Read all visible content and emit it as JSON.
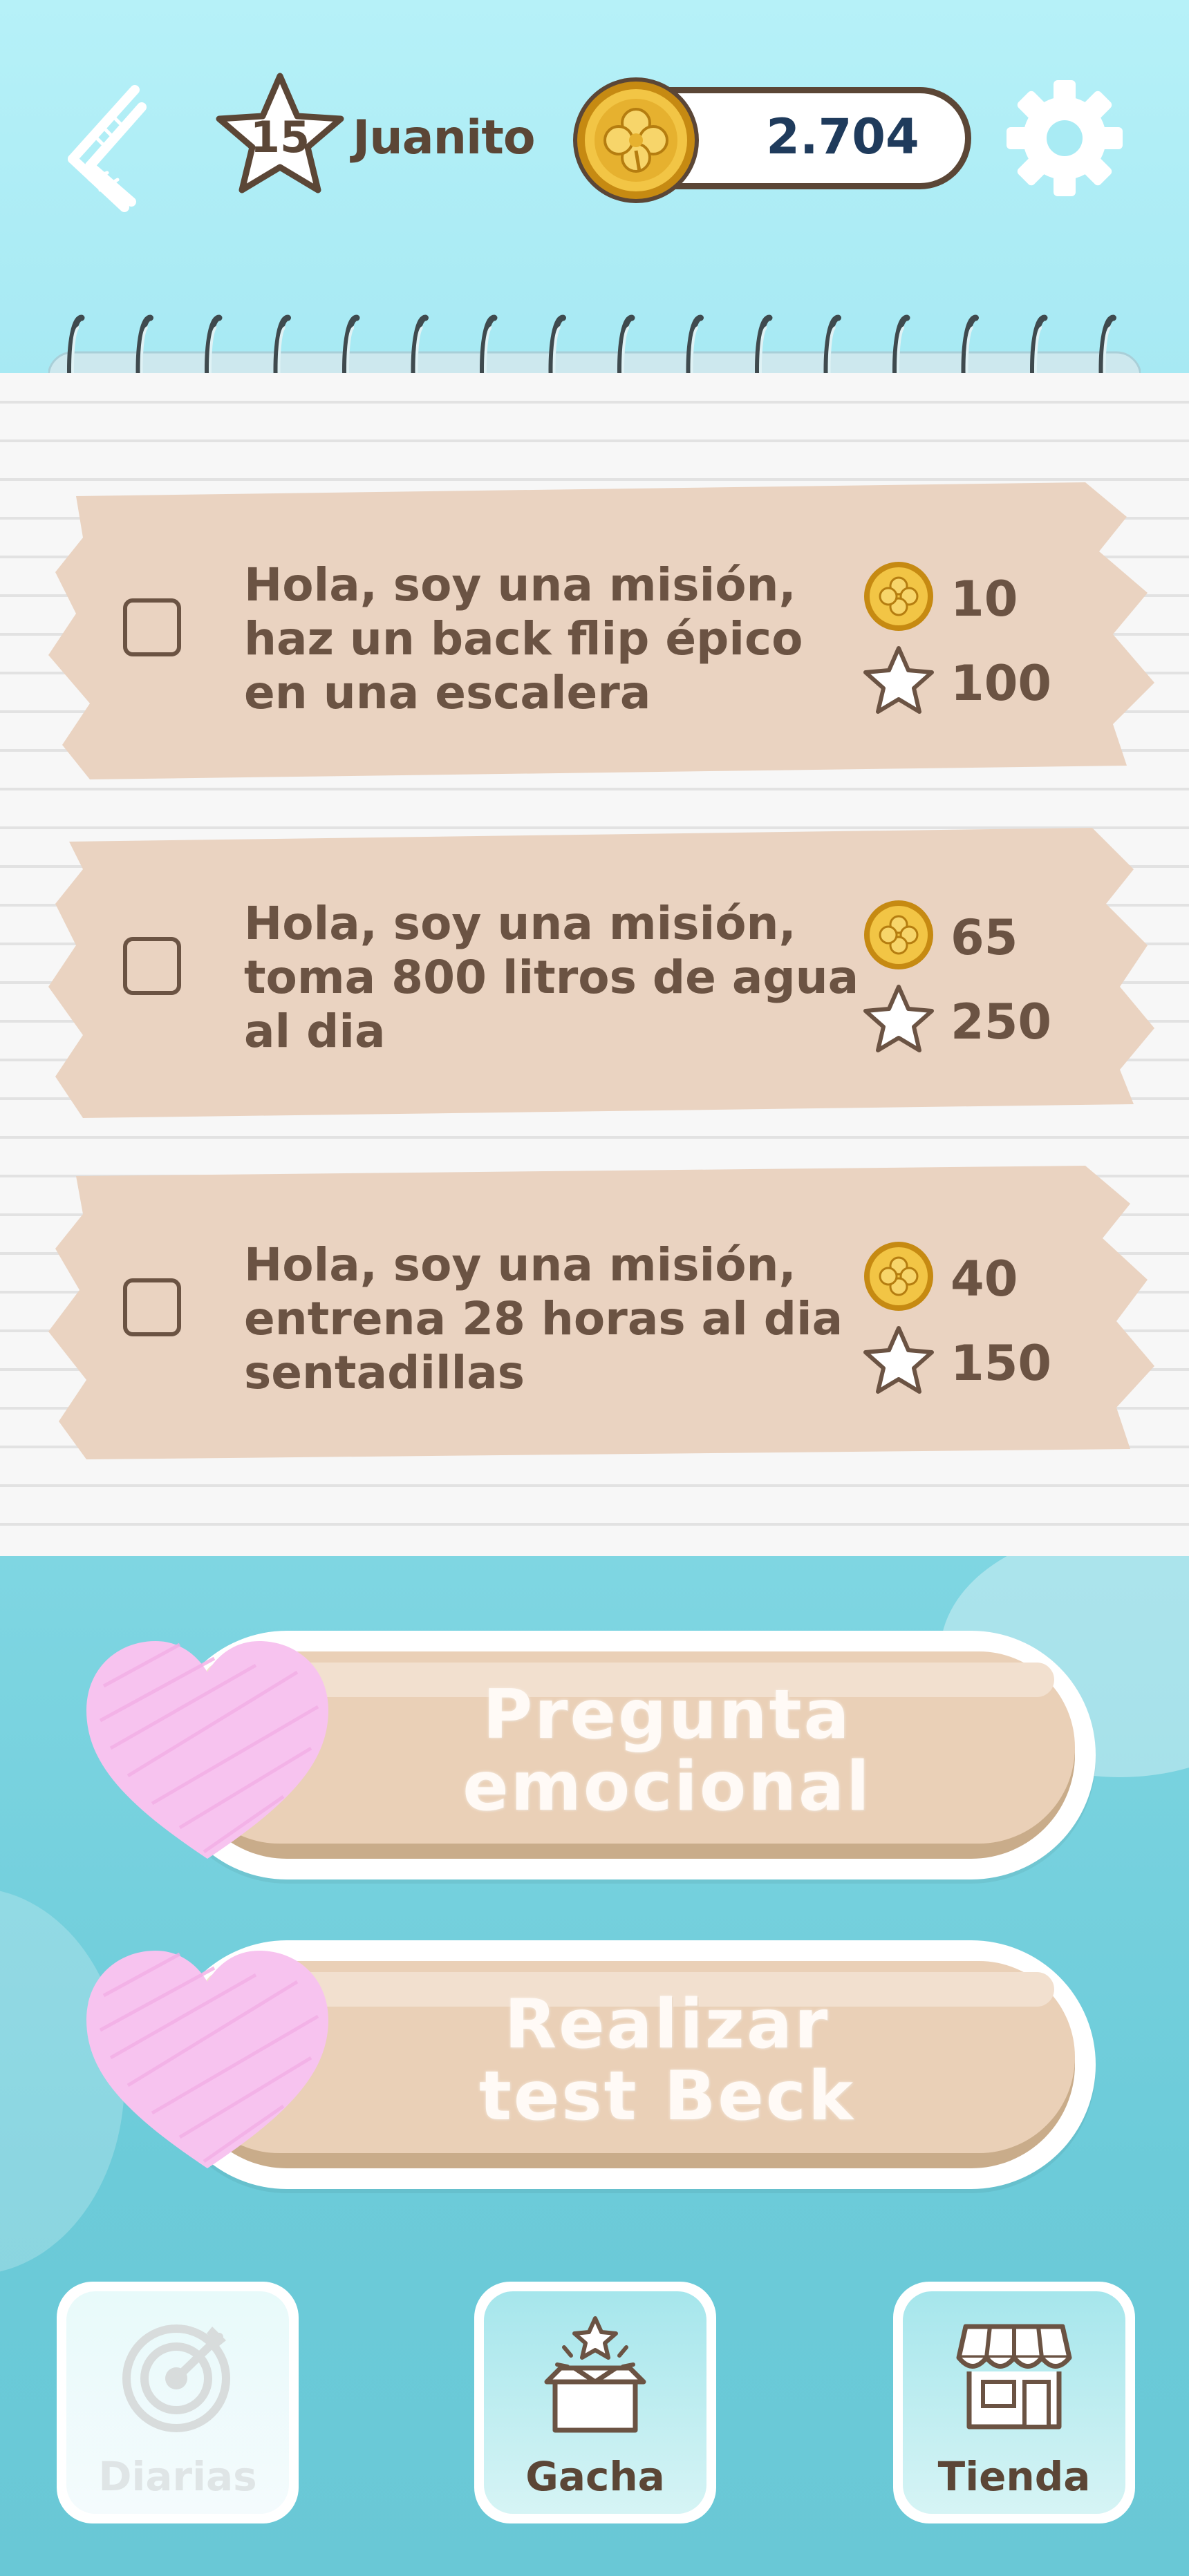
{
  "header": {
    "level": "15",
    "player_name": "Juanito",
    "coins": "2.704"
  },
  "missions": [
    {
      "lines": [
        "Hola, soy una misión,",
        "haz un back flip épico",
        "en una escalera"
      ],
      "coins": "10",
      "xp": "100",
      "checked": false
    },
    {
      "lines": [
        "Hola, soy una misión,",
        "toma 800 litros de agua",
        "al dia"
      ],
      "coins": "65",
      "xp": "250",
      "checked": false
    },
    {
      "lines": [
        "Hola, soy una misión,",
        "entrena 28 horas al dia",
        "sentadillas"
      ],
      "coins": "40",
      "xp": "150",
      "checked": false
    }
  ],
  "actions": {
    "emotional_question": [
      "Pregunta",
      "emocional"
    ],
    "beck_test": [
      "Realizar",
      "test Beck"
    ]
  },
  "nav": {
    "daily": "Diarias",
    "gacha": "Gacha",
    "shop": "Tienda"
  },
  "colors": {
    "brown_text": "#6b5343",
    "coin_text": "#1f3b5c",
    "mission_brush": "#ead3c1",
    "button_face": "#ead0b7",
    "heart": "#f7c3ef"
  },
  "icons": {
    "top_left": "logo-icon",
    "settings": "gear-icon",
    "coin": "coin-icon",
    "xp": "star-icon",
    "daily": "target-icon",
    "gacha": "gift-box-icon",
    "shop": "shop-icon"
  }
}
